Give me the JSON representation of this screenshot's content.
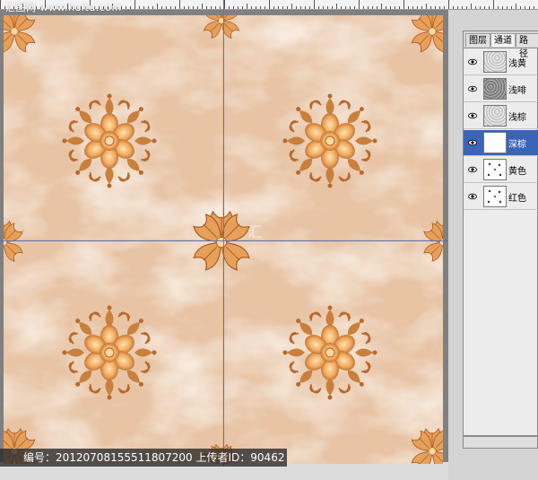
{
  "watermark": {
    "top_text": "汇图网 www.huitu.com",
    "mid_text": "汇"
  },
  "info_bar": {
    "text": "编号：20120708155511807200 上传者ID：90462"
  },
  "channels_panel": {
    "tabs": [
      {
        "label": "图层",
        "active": false
      },
      {
        "label": "通道",
        "active": true
      },
      {
        "label": "路径",
        "active": false
      }
    ],
    "channels": [
      {
        "label": "浅黄",
        "thumb": "noise-light",
        "selected": false
      },
      {
        "label": "浅啡",
        "thumb": "noise-dark",
        "selected": false
      },
      {
        "label": "浅棕",
        "thumb": "noise-light",
        "selected": false
      },
      {
        "label": "深棕",
        "thumb": "blank",
        "selected": true
      },
      {
        "label": "黄色",
        "thumb": "sparse-dots",
        "selected": false
      },
      {
        "label": "红色",
        "thumb": "sparse-dots",
        "selected": false
      }
    ]
  },
  "colors": {
    "marble_base": "#e8c4a4",
    "marble_vein": "#f6e4d2",
    "ornament_light": "#f2b974",
    "ornament_dark": "#b86a2a",
    "guide": "#5a74b8",
    "selected_row": "#3a64b8"
  }
}
